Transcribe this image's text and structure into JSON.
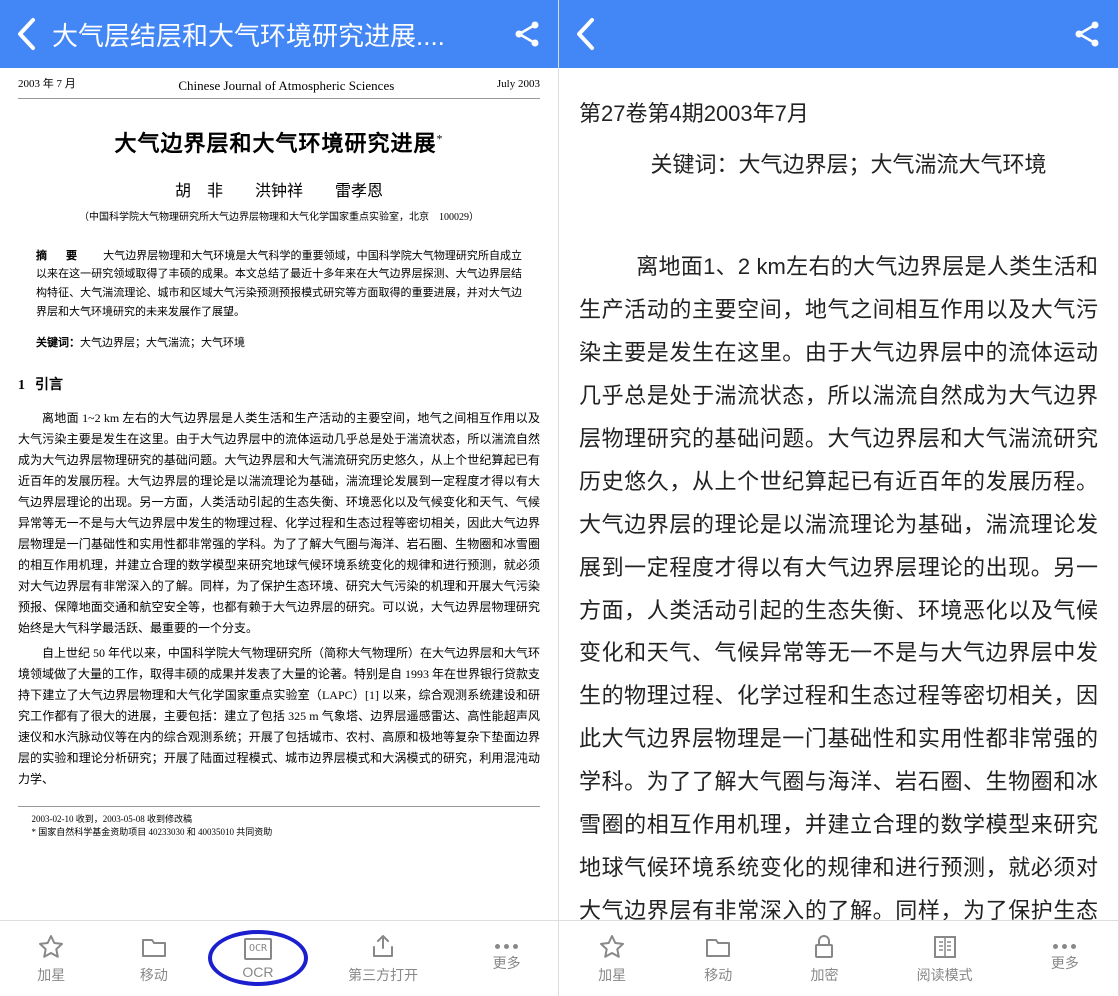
{
  "left": {
    "header": {
      "title": "大气层结层和大气环境研究进展...."
    },
    "doc": {
      "meta_left": "2003 年 7 月",
      "meta_center": "Chinese Journal of Atmospheric Sciences",
      "meta_right": "July    2003",
      "title": "大气边界层和大气环境研究进展",
      "title_mark": "*",
      "authors": "胡　非　　洪钟祥　　雷孝恩",
      "affiliation": "（中国科学院大气物理研究所大气边界层物理和大气化学国家重点实验室，北京　100029）",
      "abstract_label": "摘　要",
      "abstract": "大气边界层物理和大气环境是大气科学的重要领域，中国科学院大气物理研究所自成立以来在这一研究领域取得了丰硕的成果。本文总结了最近十多年来在大气边界层探测、大气边界层结构特征、大气湍流理论、城市和区域大气污染预测预报模式研究等方面取得的重要进展，并对大气边界层和大气环境研究的未来发展作了展望。",
      "keywords_label": "关键词：",
      "keywords": "大气边界层；大气湍流；大气环境",
      "section_num": "1",
      "section_title": "引言",
      "para1": "离地面 1~2 km 左右的大气边界层是人类生活和生产活动的主要空间，地气之间相互作用以及大气污染主要是发生在这里。由于大气边界层中的流体运动几乎总是处于湍流状态，所以湍流自然成为大气边界层物理研究的基础问题。大气边界层和大气湍流研究历史悠久，从上个世纪算起已有近百年的发展历程。大气边界层的理论是以湍流理论为基础，湍流理论发展到一定程度才得以有大气边界层理论的出现。另一方面，人类活动引起的生态失衡、环境恶化以及气候变化和天气、气候异常等无一不是与大气边界层中发生的物理过程、化学过程和生态过程等密切相关，因此大气边界层物理是一门基础性和实用性都非常强的学科。为了了解大气圈与海洋、岩石圈、生物圈和冰雪圈的相互作用机理，并建立合理的数学模型来研究地球气候环境系统变化的规律和进行预测，就必须对大气边界层有非常深入的了解。同样，为了保护生态环境、研究大气污染的机理和开展大气污染预报、保障地面交通和航空安全等，也都有赖于大气边界层的研究。可以说，大气边界层物理研究始终是大气科学最活跃、最重要的一个分支。",
      "para2": "自上世纪 50 年代以来，中国科学院大气物理研究所（简称大气物理所）在大气边界层和大气环境领域做了大量的工作，取得丰硕的成果并发表了大量的论著。特别是自 1993 年在世界银行贷款支持下建立了大气边界层物理和大气化学国家重点实验室（LAPC）[1] 以来，综合观测系统建设和研究工作都有了很大的进展，主要包括：建立了包括 325 m 气象塔、边界层遥感雷达、高性能超声风速仪和水汽脉动仪等在内的综合观测系统；开展了包括城市、农村、高原和极地等复杂下垫面边界层的实验和理论分析研究；开展了陆面过程模式、城市边界层模式和大涡模式的研究，利用混沌动力学、",
      "footer_line1": "2003-02-10 收到，2003-05-08 收到修改稿",
      "footer_line2": "* 国家自然科学基金资助项目 40233030 和 40035010 共同资助"
    },
    "nav": {
      "star": "加星",
      "move": "移动",
      "ocr": "OCR",
      "ocr_box": "OCR",
      "thirdparty": "第三方打开",
      "more": "更多"
    }
  },
  "right": {
    "text": {
      "meta": "第27卷第4期2003年7月",
      "keywords": "关键词：大气边界层；大气湍流大气环境",
      "para": "离地面1、2 km左右的大气边界层是人类生活和生产活动的主要空间，地气之间相互作用以及大气污染主要是发生在这里。由于大气边界层中的流体运动几乎总是处于湍流状态，所以湍流自然成为大气边界层物理研究的基础问题。大气边界层和大气湍流研究历史悠久，从上个世纪算起已有近百年的发展历程。大气边界层的理论是以湍流理论为基础，湍流理论发展到一定程度才得以有大气边界层理论的出现。另一方面，人类活动引起的生态失衡、环境恶化以及气候变化和天气、气候异常等无一不是与大气边界层中发生的物理过程、化学过程和生态过程等密切相关，因此大气边界层物理是一门基础性和实用性都非常强的学科。为了了解大气圈与海洋、岩石圈、生物圈和冰雪圈的相互作用机理，并建立合理的数学模型来研究地球气候环境系统变化的规律和进行预测，就必须对大气边界层有非常深入的了解。同样，为了保护生态环境、研究"
    },
    "nav": {
      "star": "加星",
      "move": "移动",
      "lock": "加密",
      "read": "阅读模式",
      "more": "更多"
    }
  }
}
